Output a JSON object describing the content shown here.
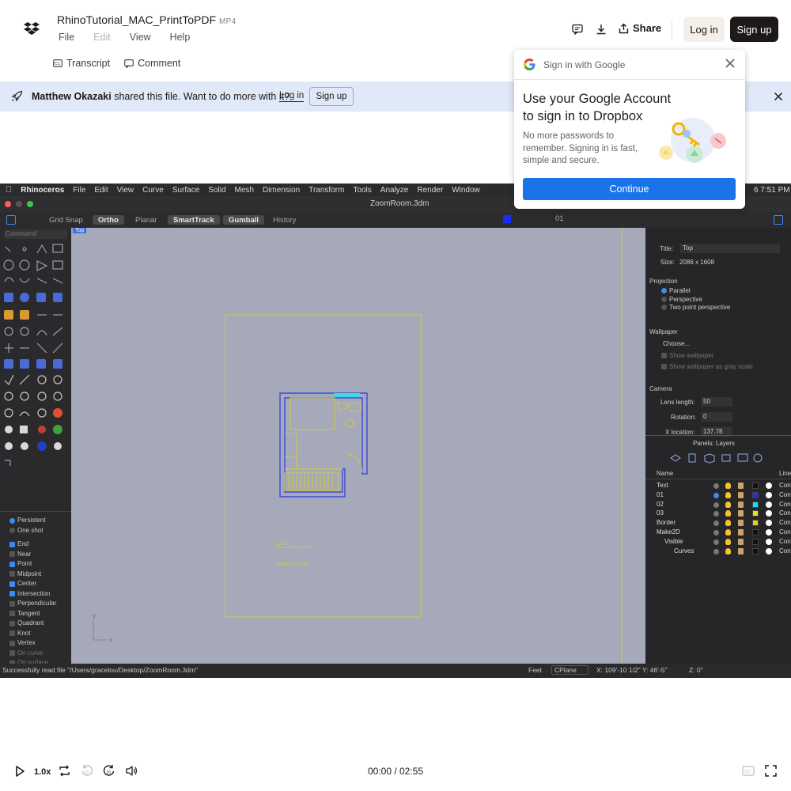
{
  "header": {
    "file_name": "RhinoTutorial_MAC_PrintToPDF",
    "file_ext": "MP4",
    "menus": [
      "File",
      "Edit",
      "View",
      "Help"
    ],
    "share_label": "Share",
    "login_label": "Log in",
    "signup_label": "Sign up"
  },
  "tabs": {
    "transcript": "Transcript",
    "comment": "Comment"
  },
  "banner": {
    "owner": "Matthew Okazaki",
    "message": " shared this file. Want to do more with it?",
    "login": "Log in",
    "signup": "Sign up"
  },
  "google": {
    "header": "Sign in with Google",
    "title": "Use your Google Account to sign in to Dropbox",
    "body": "No more passwords to remember. Signing in is fast, simple and secure.",
    "continue": "Continue"
  },
  "rhino": {
    "mac_menu": [
      "Rhinoceros",
      "File",
      "Edit",
      "View",
      "Curve",
      "Surface",
      "Solid",
      "Mesh",
      "Dimension",
      "Transform",
      "Tools",
      "Analyze",
      "Render",
      "Window"
    ],
    "clock": "6 7:51 PM",
    "doc_title": "ZoomRoom.3dm",
    "toolbar": [
      "Grid Snap",
      "Ortho",
      "Planar",
      "SmartTrack",
      "Gumball",
      "History"
    ],
    "toolbar_on": [
      false,
      true,
      false,
      true,
      true,
      false
    ],
    "layer_field": "01",
    "command_placeholder": "Command",
    "viewport_tab": "Top",
    "snap_modes": [
      {
        "label": "Persistent",
        "on": true
      },
      {
        "label": "One shot",
        "on": false
      }
    ],
    "osnaps": [
      {
        "label": "End",
        "on": true
      },
      {
        "label": "Near",
        "on": false
      },
      {
        "label": "Point",
        "on": true
      },
      {
        "label": "Midpoint",
        "on": false
      },
      {
        "label": "Center",
        "on": true
      },
      {
        "label": "Intersection",
        "on": true
      },
      {
        "label": "Perpendicular",
        "on": false
      },
      {
        "label": "Tangent",
        "on": false
      },
      {
        "label": "Quadrant",
        "on": false
      },
      {
        "label": "Knot",
        "on": false
      },
      {
        "label": "Vertex",
        "on": false
      },
      {
        "label": "On curve",
        "on": false
      },
      {
        "label": "On surface",
        "on": false
      }
    ],
    "plan_title": "GRACE'S PLAN",
    "scale_text": "0  1  2          5",
    "axis_y": "y",
    "axis_x": "x",
    "props": {
      "title_label": "Title:",
      "title_value": "Top",
      "size_label": "Size:",
      "size_value": "2086 x 1608",
      "projection": "Projection",
      "proj_options": [
        "Parallel",
        "Perspective",
        "Two point perspective"
      ],
      "wallpaper": "Wallpaper",
      "choose": "Choose...",
      "show_wallpaper": "Show wallpaper",
      "show_gray": "Show wallpaper as gray scale",
      "camera": "Camera",
      "lens_label": "Lens length:",
      "lens_value": "50",
      "rotation_label": "Rotation:",
      "rotation_value": "0",
      "xloc_label": "X location:",
      "xloc_value": "137.78"
    },
    "layers_title": "Panels: Layers",
    "layers_col_name": "Name",
    "layers_col_line": "Line",
    "layers": [
      {
        "name": "Text",
        "color": "#111111"
      },
      {
        "name": "01",
        "color": "#1a2bff"
      },
      {
        "name": "02",
        "color": "#16e0f0"
      },
      {
        "name": "03",
        "color": "#f0e020"
      },
      {
        "name": "Border",
        "color": "#e0d020"
      },
      {
        "name": "Make2D",
        "color": "#111111"
      },
      {
        "name": "Visible",
        "color": "#111111"
      },
      {
        "name": "Curves",
        "color": "#111111"
      }
    ],
    "layer_line_text": "Con",
    "status_msg": "Successfully read file \"/Users/gracelou/Desktop/ZoomRoom.3dm\"",
    "units": "Feet",
    "cplane": "CPlane",
    "coords": "X: 109'-10 1/2\"  Y: 46'-5\"",
    "z": "Z: 0\""
  },
  "player": {
    "speed": "1.0x",
    "time": "00:00 / 02:55"
  }
}
